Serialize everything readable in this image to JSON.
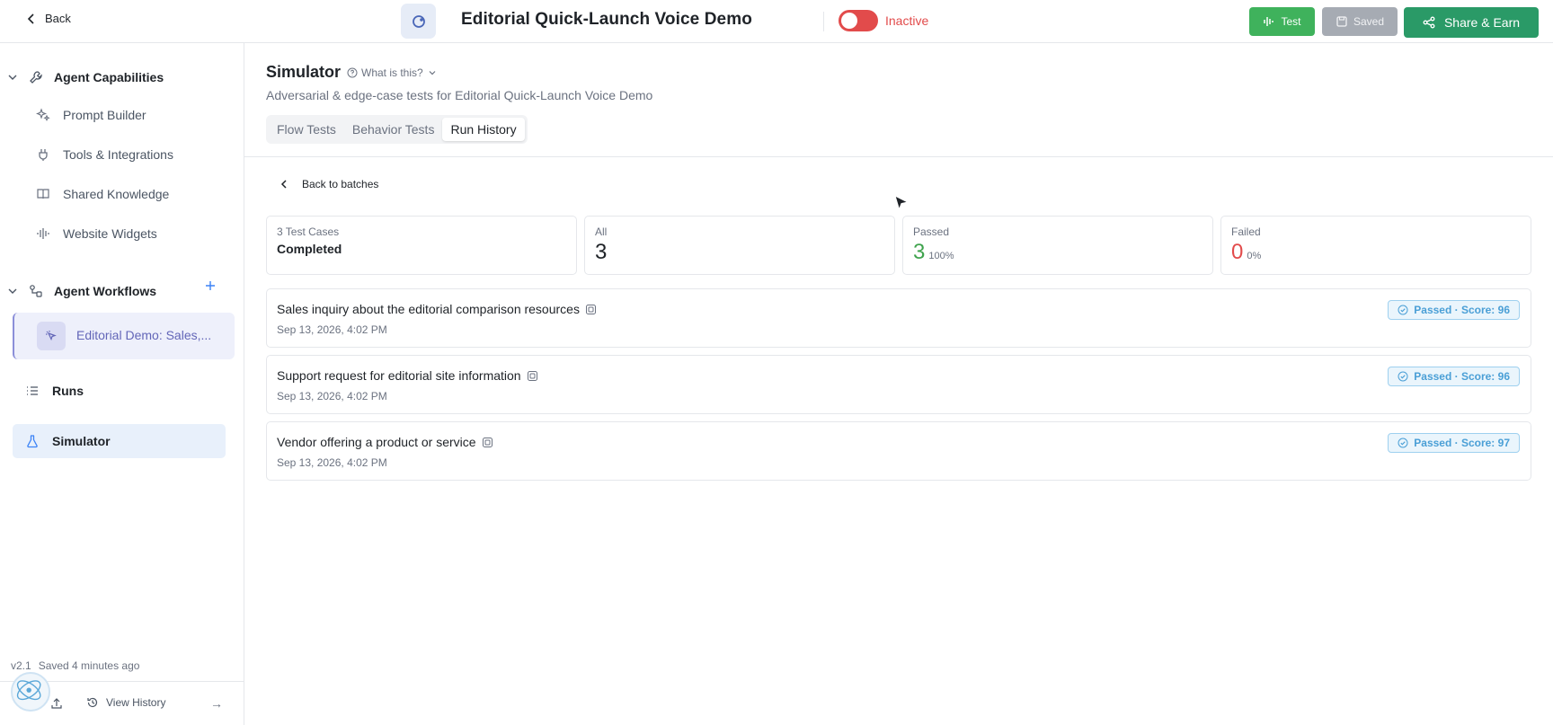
{
  "header": {
    "back_label": "Back",
    "title": "Editorial Quick-Launch Voice Demo",
    "status": "Inactive",
    "status_color": "#e24b4b",
    "test_label": "Test",
    "saved_label": "Saved",
    "share_label": "Share & Earn"
  },
  "sidebar": {
    "capabilities_heading": "Agent Capabilities",
    "capability_items": [
      {
        "label": "Prompt Builder",
        "icon": "sparkles-icon"
      },
      {
        "label": "Tools & Integrations",
        "icon": "plug-icon"
      },
      {
        "label": "Shared Knowledge",
        "icon": "book-icon"
      },
      {
        "label": "Website Widgets",
        "icon": "waveform-icon"
      }
    ],
    "workflows_heading": "Agent Workflows",
    "active_workflow": "Editorial Demo: Sales,...",
    "runs_label": "Runs",
    "simulator_label": "Simulator",
    "version": "v2.1",
    "saved_text": "Saved 4 minutes ago",
    "view_history_label": "View History",
    "arrow": "→"
  },
  "main": {
    "title": "Simulator",
    "what_is_this": "What is this?",
    "subtitle": "Adversarial & edge-case tests for Editorial Quick-Launch Voice Demo",
    "tabs": [
      {
        "label": "Flow Tests"
      },
      {
        "label": "Behavior Tests"
      },
      {
        "label": "Run History"
      }
    ],
    "back_to_batches": "Back to batches",
    "stats": {
      "cases_label": "3 Test Cases",
      "cases_status": "Completed",
      "all_label": "All",
      "all_value": "3",
      "passed_label": "Passed",
      "passed_value": "3",
      "passed_pct": "100%",
      "failed_label": "Failed",
      "failed_value": "0",
      "failed_pct": "0%"
    },
    "cases": [
      {
        "title": "Sales inquiry about the editorial comparison resources",
        "date": "Sep 13, 2026, 4:02 PM",
        "badge": "Passed · Score: 96"
      },
      {
        "title": "Support request for editorial site information",
        "date": "Sep 13, 2026, 4:02 PM",
        "badge": "Passed · Score: 96"
      },
      {
        "title": "Vendor offering a product or service",
        "date": "Sep 13, 2026, 4:02 PM",
        "badge": "Passed · Score: 97"
      }
    ]
  },
  "colors": {
    "accent_green": "#3fb25c",
    "share_green": "#2a9a67",
    "passed_green": "#3fa34d",
    "failed_red": "#e24b4b",
    "badge_blue": "#4a9fd6"
  }
}
